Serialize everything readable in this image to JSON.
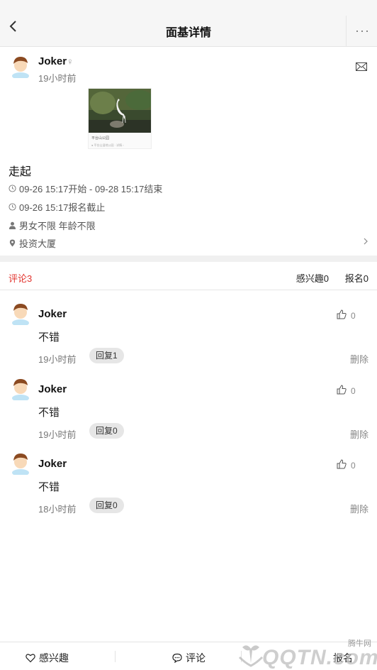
{
  "nav": {
    "title": "面基详情",
    "more": "···"
  },
  "post": {
    "author": "Joker",
    "gender_symbol": "♀",
    "time": "19小时前",
    "image_caption": "平台山公园",
    "image_footer": "● 平台山湿地公园 · 详情 ›",
    "title": "走起",
    "start_end": "09-26 15:17开始 - 09-28 15:17结束",
    "deadline": "09-26 15:17报名截止",
    "requirements": "男女不限 年龄不限",
    "location": "投资大厦"
  },
  "tabs": {
    "comments": "评论3",
    "interested": "感兴趣0",
    "signed_up": "报名0"
  },
  "comments": [
    {
      "name": "Joker",
      "text": "不错",
      "time": "19小时前",
      "reply": "回复1",
      "likes": "0",
      "delete": "删除"
    },
    {
      "name": "Joker",
      "text": "不错",
      "time": "19小时前",
      "reply": "回复0",
      "likes": "0",
      "delete": "删除"
    },
    {
      "name": "Joker",
      "text": "不错",
      "time": "18小时前",
      "reply": "回复0",
      "likes": "0",
      "delete": "删除"
    }
  ],
  "bottom": {
    "interest": "感兴趣",
    "comment": "评论",
    "signup": "报名"
  },
  "watermark": {
    "top": "腾牛网",
    "main": "QQTN.com"
  },
  "colors": {
    "accent_red": "#e2352f",
    "nav_bg": "#f6f6f6",
    "divider": "#f0f0f0"
  },
  "icons": [
    "back-arrow-icon",
    "more-icon",
    "mail-icon",
    "clock-icon",
    "person-icon",
    "location-pin-icon",
    "chevron-right-icon",
    "thumbs-up-icon",
    "heart-icon",
    "comment-bubble-icon"
  ]
}
